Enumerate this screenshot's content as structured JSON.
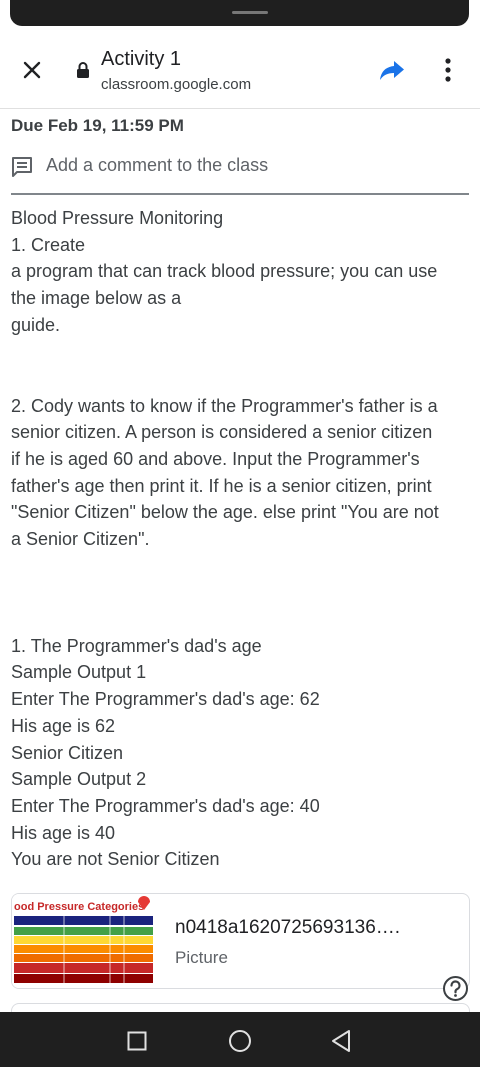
{
  "browser": {
    "title": "Activity 1",
    "url": "classroom.google.com"
  },
  "assignment": {
    "due": "Due Feb 19, 11:59 PM",
    "comment_prompt": "Add a comment to the class",
    "description_lines_1": [
      "Blood Pressure Monitoring",
      "1. Create",
      "a program that can track blood pressure; you can use",
      "the image below as a",
      "guide."
    ],
    "description_lines_2": [
      "2. Cody wants to know if the Programmer's father is a",
      "senior citizen. A person is considered a senior citizen",
      "if he is aged 60 and above. Input the Programmer's",
      "father's age then print it. If he is a senior citizen, print",
      "\"Senior Citizen\" below the age. else print \"You are not",
      "a Senior Citizen\"."
    ],
    "description_lines_3": [
      "1. The Programmer's dad's age",
      "Sample Output 1",
      "Enter The Programmer's dad's age: 62",
      "His age is 62",
      "Senior Citizen",
      "Sample Output 2",
      "Enter The Programmer's dad's age: 40",
      "His age is 40",
      "You are not Senior Citizen"
    ]
  },
  "attachment": {
    "thumb_caption": "ood Pressure Categories",
    "title": "n0418a1620725693136….",
    "type": "Picture"
  },
  "colors": {
    "share_blue": "#1a73e8",
    "nav_bg": "#1f1f1f"
  }
}
